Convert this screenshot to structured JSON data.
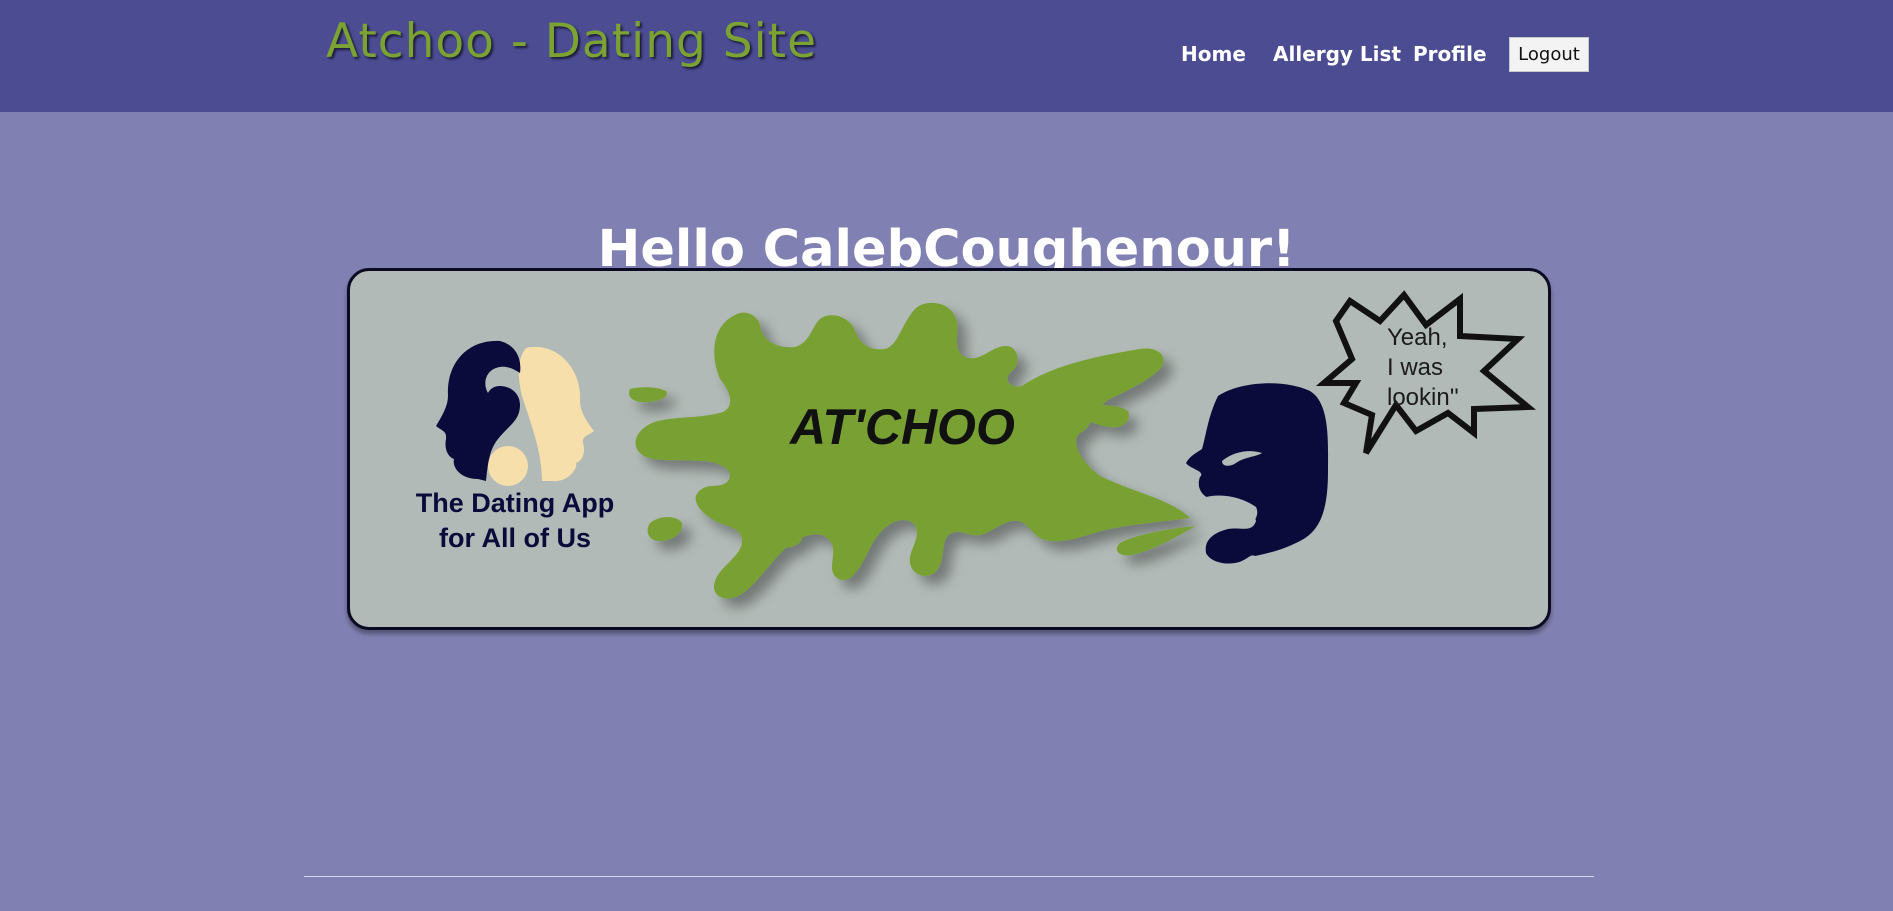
{
  "navbar": {
    "brand": "Atchoo - Dating Site",
    "links": [
      {
        "label": "Home"
      },
      {
        "label": "Allergy List"
      },
      {
        "label": "Profile"
      }
    ],
    "logout_label": "Logout"
  },
  "main": {
    "greeting": "Hello CalebCoughenour!",
    "banner": {
      "tagline_line1": "The Dating App",
      "tagline_line2": "for All of Us",
      "splat_text": "AT'CHOO",
      "speech_bubble": [
        "Yeah,",
        "I was",
        "lookin''"
      ]
    }
  },
  "colors": {
    "navbar_bg": "#4b4c92",
    "page_bg": "#8080b2",
    "brand_green": "#7ba232",
    "banner_bg": "#b1bab6",
    "dark_navy": "#0b0b3b",
    "cream": "#f7dfac"
  }
}
